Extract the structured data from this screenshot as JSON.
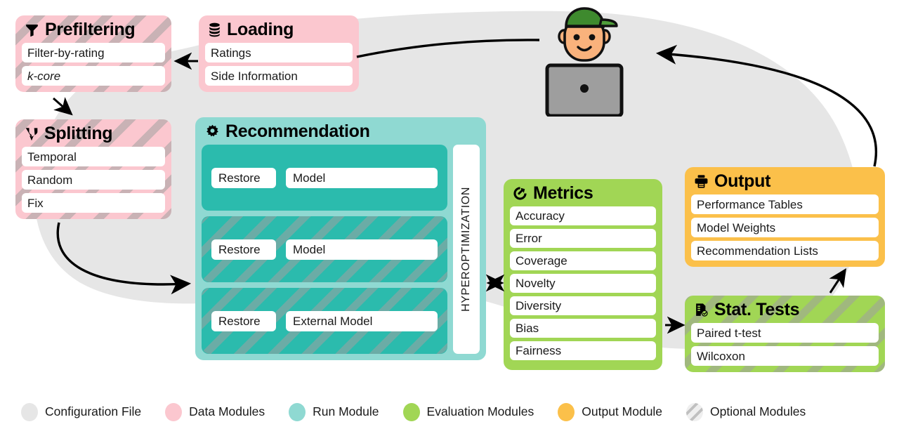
{
  "colors": {
    "config_gray": "#E6E6E6",
    "data_pink": "#FBC7CF",
    "run_teal_light": "#8FD9D2",
    "run_teal_dark": "#2BBBAD",
    "eval_green": "#A1D655",
    "output_orange": "#FBC04A",
    "hatch_gray": "#A8A8A8",
    "white": "#FFFFFF",
    "black": "#000000"
  },
  "modules": {
    "prefiltering": {
      "title": "Prefiltering",
      "icon": "filter-funnel-icon",
      "optional": true,
      "items": [
        "Filter-by-rating",
        "k-core"
      ]
    },
    "loading": {
      "title": "Loading",
      "icon": "database-icon",
      "optional": false,
      "items": [
        "Ratings",
        "Side Information"
      ]
    },
    "splitting": {
      "title": "Splitting",
      "icon": "split-branch-icon",
      "optional": true,
      "items": [
        "Temporal",
        "Random",
        "Fix"
      ]
    },
    "recommendation": {
      "title": "Recommendation",
      "icon": "gear-icon",
      "hyperoptimization_label": "HYPEROPTIMIZATION",
      "runs": [
        {
          "restore": "Restore",
          "model": "Model",
          "optional": false
        },
        {
          "restore": "Restore",
          "model": "Model",
          "optional": true
        },
        {
          "restore": "Restore",
          "model": "External Model",
          "optional": true
        }
      ]
    },
    "metrics": {
      "title": "Metrics",
      "icon": "gauge-icon",
      "optional": false,
      "items": [
        "Accuracy",
        "Error",
        "Coverage",
        "Novelty",
        "Diversity",
        "Bias",
        "Fairness"
      ]
    },
    "output": {
      "title": "Output",
      "icon": "printer-icon",
      "optional": false,
      "items": [
        "Performance Tables",
        "Model Weights",
        "Recommendation Lists"
      ]
    },
    "stattests": {
      "title": "Stat. Tests",
      "icon": "document-check-icon",
      "optional": true,
      "items": [
        "Paired t-test",
        "Wilcoxon"
      ]
    }
  },
  "person": {
    "name": "user-at-laptop-illustration",
    "cap_color": "#3E8A2E",
    "skin_color": "#F9B27C",
    "sweater_color": "#111111",
    "laptop_color": "#9E9E9E"
  },
  "legend": {
    "items": [
      {
        "label": "Configuration File",
        "color": "#E6E6E6",
        "hatched": false
      },
      {
        "label": "Data Modules",
        "color": "#FBC7CF",
        "hatched": false
      },
      {
        "label": "Run Module",
        "color": "#8FD9D2",
        "hatched": false
      },
      {
        "label": "Evaluation Modules",
        "color": "#A1D655",
        "hatched": false
      },
      {
        "label": "Output Module",
        "color": "#FBC04A",
        "hatched": false
      },
      {
        "label": "Optional Modules",
        "color": "#EFEFEF",
        "hatched": true
      }
    ]
  }
}
